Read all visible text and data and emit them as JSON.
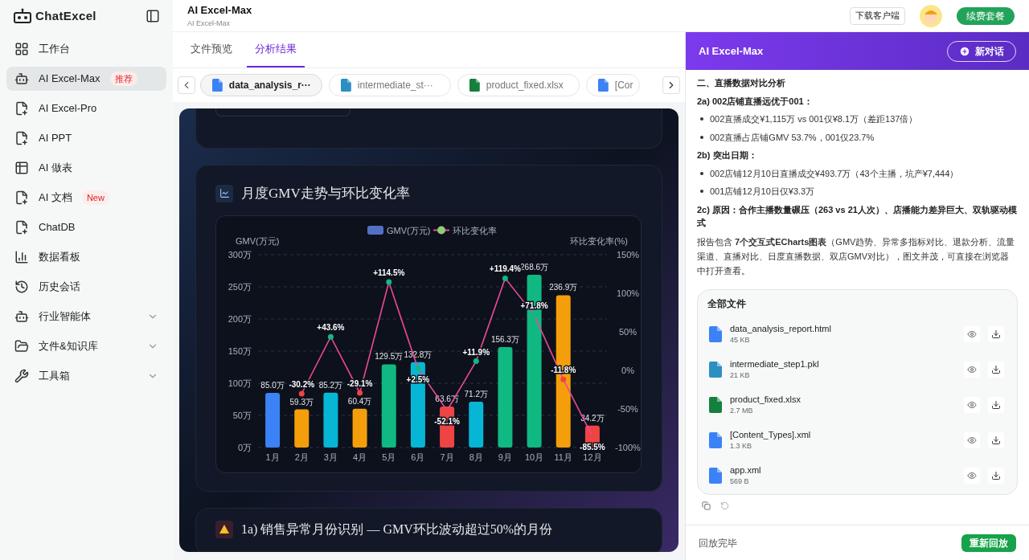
{
  "sidebar": {
    "logo": "ChatExcel",
    "items": [
      {
        "label": "工作台",
        "selected": false
      },
      {
        "label": "AI Excel-Max",
        "selected": true,
        "badge": "推荐"
      },
      {
        "label": "AI Excel-Pro",
        "selected": false
      },
      {
        "label": "AI PPT",
        "selected": false
      },
      {
        "label": "AI 做表",
        "selected": false
      },
      {
        "label": "AI 文档",
        "selected": false,
        "badge": "New"
      },
      {
        "label": "ChatDB",
        "selected": false
      },
      {
        "label": "数据看板",
        "selected": false
      },
      {
        "label": "历史会话",
        "selected": false
      },
      {
        "label": "行业智能体",
        "selected": false,
        "expanded": false
      },
      {
        "label": "文件&知识库",
        "selected": false,
        "expanded": false
      },
      {
        "label": "工具箱",
        "selected": false,
        "expanded": false
      }
    ]
  },
  "header": {
    "title": "AI Excel-Max",
    "subtitle": "AI Excel-Max",
    "download": "下载客户端",
    "renew": "续费套餐"
  },
  "tabs": [
    {
      "label": "文件预览",
      "selected": false
    },
    {
      "label": "分析结果",
      "selected": true
    }
  ],
  "file_chips": [
    {
      "name": "data_analysis_r···",
      "color": "#3b82f6",
      "selected": true
    },
    {
      "name": "intermediate_st···",
      "color": "#2b8fc2",
      "selected": false
    },
    {
      "name": "product_fixed.xlsx",
      "color": "#15803d",
      "selected": false
    },
    {
      "name": "[Cor",
      "color": "#3b82f6",
      "selected": false
    }
  ],
  "report": {
    "chart_card_title": "月度GMV走势与环比变化率",
    "next_card_title": "1a) 销售异常月份识别 — GMV环比波动超过50%的月份",
    "gmv_chart": {
      "chart_data": {
        "type": "bar",
        "ylabel": "GMV(万元)",
        "grid": true,
        "categories": [
          "1月",
          "2月",
          "3月",
          "4月",
          "5月",
          "6月",
          "7月",
          "8月",
          "9月",
          "10月",
          "11月",
          "12月"
        ],
        "series": [
          {
            "name": "GMV(万元)",
            "color": "#5470c6",
            "colors": [
              "#3b82f6",
              "#f59e0b",
              "#06b6d4",
              "#f59e0b",
              "#10b981",
              "#06b6d4",
              "#ef4444",
              "#06b6d4",
              "#10b981",
              "#10b981",
              "#f59e0b",
              "#ef4444"
            ],
            "values": [
              85.0,
              59.3,
              85.2,
              60.4,
              129.5,
              132.8,
              63.6,
              71.2,
              156.3,
              268.6,
              236.9,
              34.2
            ],
            "value_labels": [
              "85.0万",
              "59.3万",
              "85.2万",
              "60.4万",
              "129.5万",
              "132.8万",
              "63.6万",
              "71.2万",
              "156.3万",
              "268.6万",
              "236.9万",
              "34.2万"
            ]
          }
        ],
        "ylim": [
          0,
          300
        ],
        "yticks": [
          {
            "value": 0,
            "label": "0万"
          },
          {
            "value": 50,
            "label": "50万"
          },
          {
            "value": 100,
            "label": "100万"
          },
          {
            "value": 150,
            "label": "150万"
          },
          {
            "value": 200,
            "label": "200万"
          },
          {
            "value": 250,
            "label": "250万"
          },
          {
            "value": 300,
            "label": "300万"
          }
        ]
      }
    },
    "rate_chart": {
      "chart_data": {
        "type": "line",
        "ylabel": "环比变化率(%)",
        "series": [
          {
            "name": "环比变化率",
            "color": "#ec4899",
            "marker": "circle",
            "values": [
              null,
              -30.2,
              43.6,
              -29.1,
              114.5,
              2.5,
              -52.1,
              11.9,
              119.4,
              71.8,
              -11.8,
              -85.5
            ],
            "value_labels": [
              null,
              "-30.2%",
              "+43.6%",
              "-29.1%",
              "+114.5%",
              "+2.5%",
              "-52.1%",
              "+11.9%",
              "+119.4%",
              "+71.8%",
              "-11.8%",
              "-85.5%"
            ]
          }
        ],
        "ylim": [
          -100,
          150
        ],
        "yticks": [
          {
            "value": -100,
            "label": "-100%"
          },
          {
            "value": -50,
            "label": "-50%"
          },
          {
            "value": 0,
            "label": "0%"
          },
          {
            "value": 50,
            "label": "50%"
          },
          {
            "value": 100,
            "label": "100%"
          },
          {
            "value": 150,
            "label": "150%"
          }
        ]
      }
    }
  },
  "assistant": {
    "title": "AI Excel-Max",
    "new_chat": "新对话",
    "blocks": [
      {
        "kind": "heading",
        "text": "二、直播数据对比分析"
      },
      {
        "kind": "heading",
        "text": "2a) 002店铺直播远优于001："
      },
      {
        "kind": "bullet",
        "text": "002直播成交¥1,115万 vs 001仅¥8.1万（差距137倍）"
      },
      {
        "kind": "bullet",
        "text": "002直播占店铺GMV 53.7%，001仅23.7%"
      },
      {
        "kind": "heading",
        "text": "2b) 突出日期："
      },
      {
        "kind": "bullet",
        "text": "002店铺12月10日直播成交¥493.7万（43个主播，坑产¥7,444）"
      },
      {
        "kind": "bullet",
        "text": "001店铺12月10日仅¥3.3万"
      },
      {
        "kind": "heading",
        "text": "2c) 原因：合作主播数量碾压（263 vs 21人次）、店播能力差异巨大、双轨驱动模式"
      },
      {
        "kind": "paragraph",
        "text": "报告包含 **7个交互式ECharts图表**（GMV趋势、异常多指标对比、退款分析、流量渠道、直播对比、日度直播数据、双店GMV对比），图文并茂，可直接在浏览器中打开查看。"
      }
    ],
    "files_title": "全部文件",
    "files": [
      {
        "name": "data_analysis_report.html",
        "size": "45 KB",
        "color": "#3b82f6"
      },
      {
        "name": "intermediate_step1.pkl",
        "size": "21 KB",
        "color": "#2b8fc2"
      },
      {
        "name": "product_fixed.xlsx",
        "size": "2.7 MB",
        "color": "#15803d"
      },
      {
        "name": "[Content_Types].xml",
        "size": "1.3 KB",
        "color": "#3b82f6"
      },
      {
        "name": "app.xml",
        "size": "569 B",
        "color": "#3b82f6"
      }
    ],
    "status": "回放完毕",
    "replay": "重新回放"
  }
}
